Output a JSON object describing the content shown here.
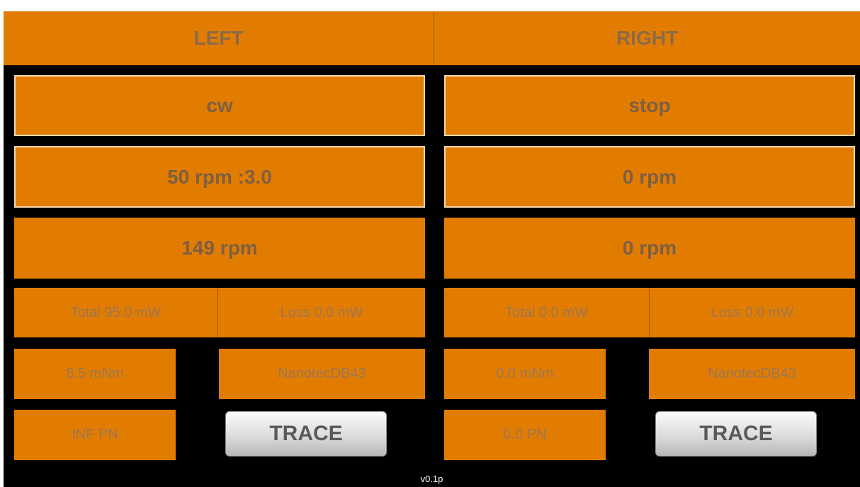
{
  "left": {
    "header": "LEFT",
    "direction": "cw",
    "set_speed": "50 rpm :3.0",
    "actual_speed": "149 rpm",
    "total_power": "Total 95.0 mW",
    "loss_power": "Loss 0.0 mW",
    "torque": "8.5 mNm",
    "motor": "NanotecDB43",
    "pn": "INF PN",
    "trace_label": "TRACE"
  },
  "right": {
    "header": "RIGHT",
    "direction": "stop",
    "set_speed": "0 rpm",
    "actual_speed": "0 rpm",
    "total_power": "Total 0.0 mW",
    "loss_power": "Loss 0.0 mW",
    "torque": "0.0 mNm",
    "motor": "NanotecDB43",
    "pn": "0.0 PN",
    "trace_label": "TRACE"
  },
  "version": "v0.1p",
  "colors": {
    "panel_orange": "#e27c00",
    "background": "#000000",
    "outline": "#f1d7b0"
  }
}
